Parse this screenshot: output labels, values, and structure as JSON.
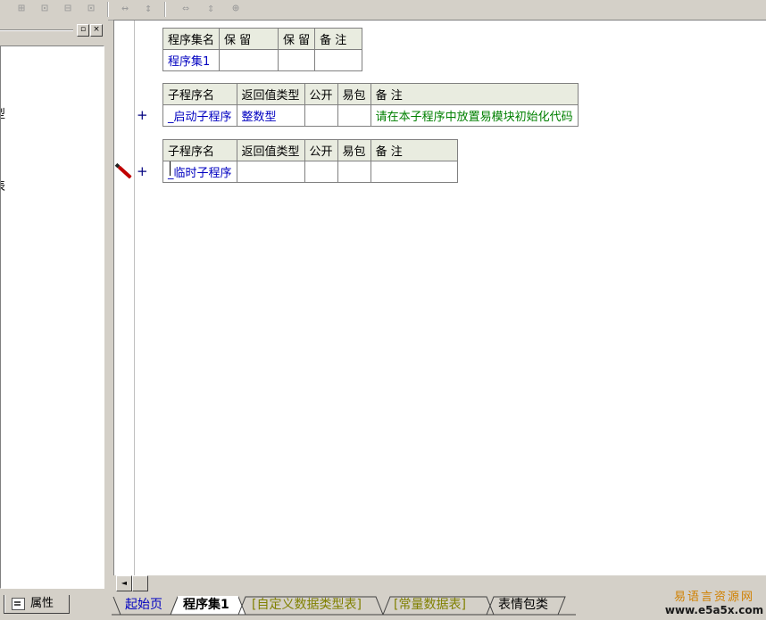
{
  "toolbar": {
    "buttons": [
      "left-align-icon",
      "center-align-icon",
      "top-align-icon",
      "bottom-align-icon",
      "equal-width-icon",
      "equal-height-icon",
      "same-width-icon",
      "same-height-icon",
      "same-size-icon"
    ]
  },
  "left_panel": {
    "restore_button": "▫",
    "close_button": "×",
    "tree_fragments": [
      "型",
      "表"
    ],
    "props_tab_label": "属性"
  },
  "assembly_table": {
    "headers": [
      "程序集名",
      "保 留",
      "保 留",
      "备 注"
    ],
    "row": [
      "程序集1",
      "",
      "",
      ""
    ]
  },
  "sub1_table": {
    "headers": [
      "子程序名",
      "返回值类型",
      "公开",
      "易包",
      "备 注"
    ],
    "row": [
      "_启动子程序",
      "整数型",
      "",
      "",
      "请在本子程序中放置易模块初始化代码"
    ]
  },
  "sub2_table": {
    "headers": [
      "子程序名",
      "返回值类型",
      "公开",
      "易包",
      "备 注"
    ],
    "row": [
      "_临时子程序",
      "",
      "",
      "",
      ""
    ]
  },
  "markers": {
    "expand": "+"
  },
  "scroll": {
    "left_arrow": "◄"
  },
  "tabs": [
    {
      "label": "起始页",
      "color": "#0000c0"
    },
    {
      "label": "程序集1",
      "color": "#000000"
    },
    {
      "label": "[自定义数据类型表]",
      "color": "#808000"
    },
    {
      "label": "[常量数据表]",
      "color": "#808000"
    },
    {
      "label": "表情包类",
      "color": "#000000"
    }
  ],
  "watermark": {
    "title": "易语言资源网",
    "url": "www.e5a5x.com"
  }
}
